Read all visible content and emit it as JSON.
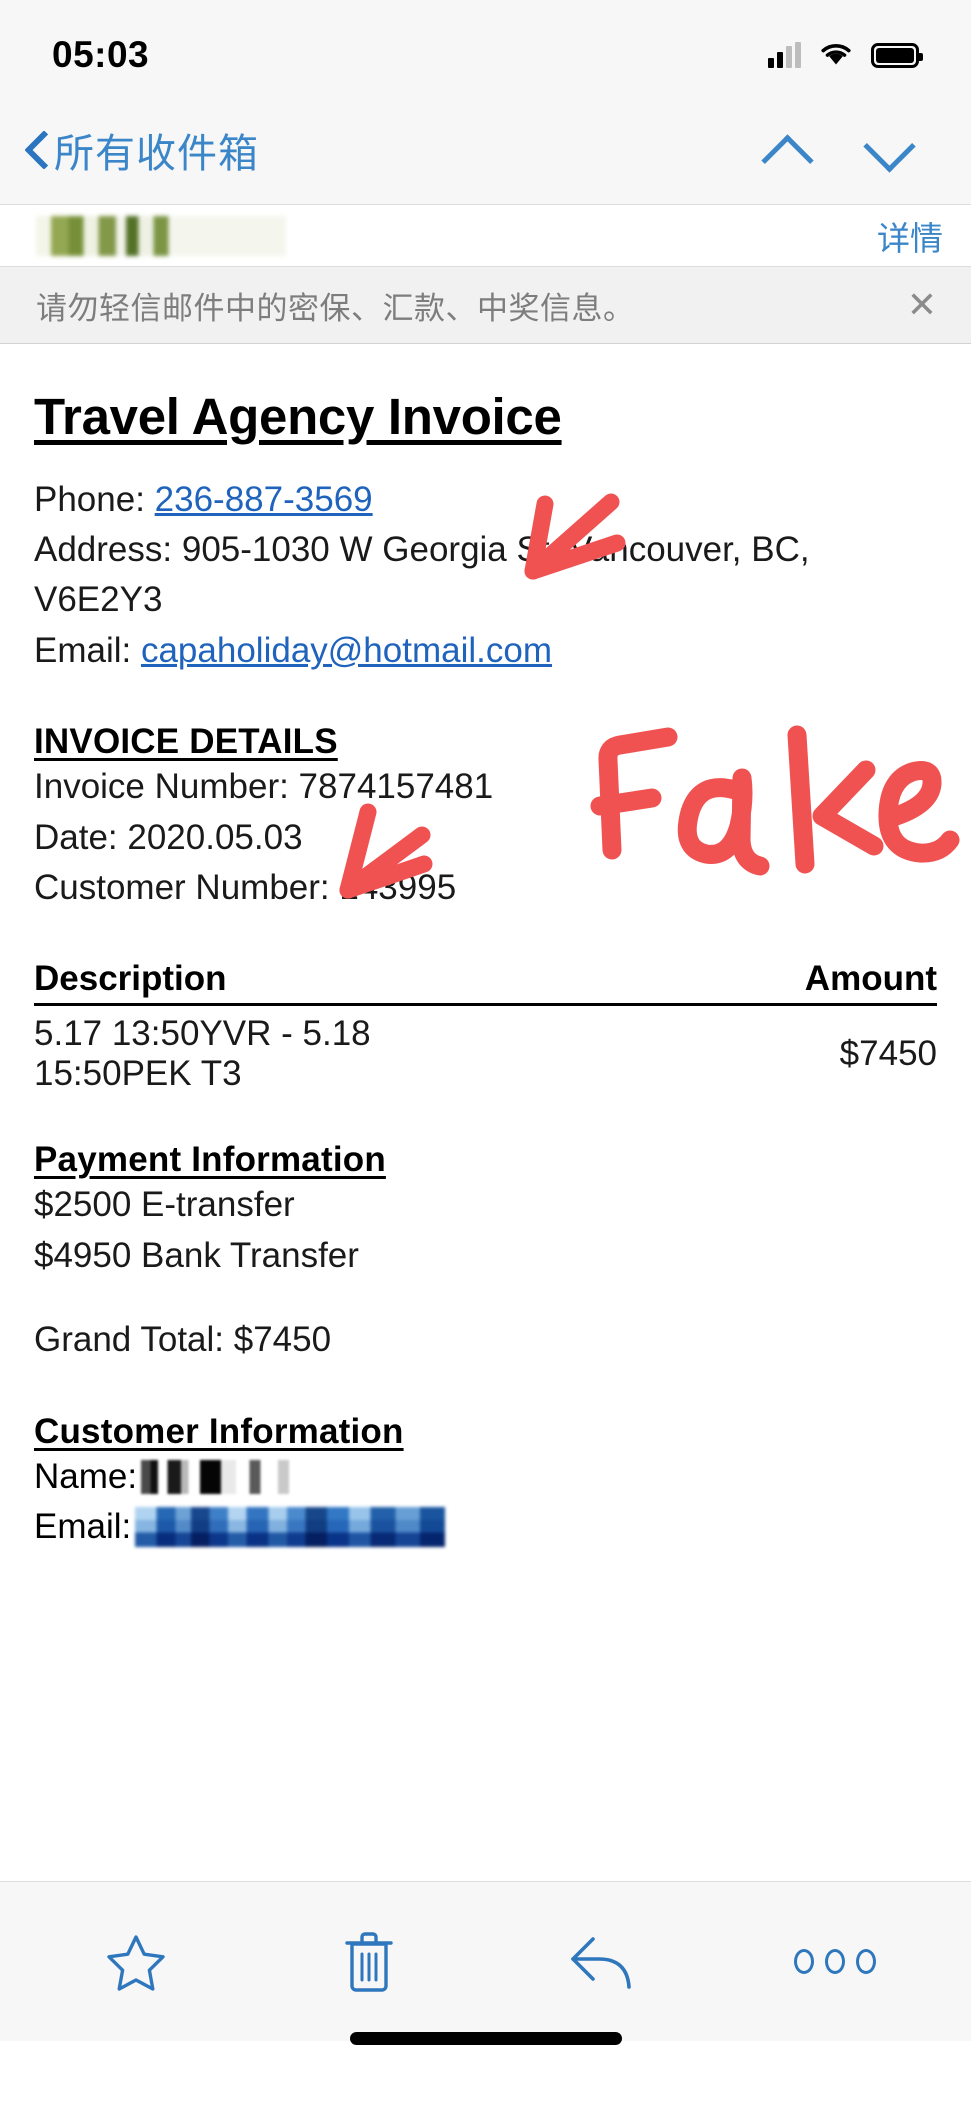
{
  "status_bar": {
    "time": "05:03",
    "signal_icon": "cellular-bars-icon",
    "wifi_icon": "wifi-icon",
    "battery_icon": "battery-full-icon"
  },
  "nav_bar": {
    "back_label": "所有收件箱",
    "back_icon": "chevron-left-icon",
    "prev_message_icon": "chevron-up-icon",
    "next_message_icon": "chevron-down-icon"
  },
  "sender_row": {
    "sender_redacted": "",
    "details_label": "详情"
  },
  "warning_banner": {
    "text": "请勿轻信邮件中的密保、汇款、中奖信息。",
    "close_icon": "close-icon",
    "close_glyph": "✕"
  },
  "invoice": {
    "title": "Travel Agency Invoice",
    "contact": {
      "phone_label": "Phone: ",
      "phone_value": "236-887-3569",
      "address_label": "Address: ",
      "address_value": "905-1030 W Georgia St, Vancouver, BC, V6E2Y3",
      "email_label": "Email: ",
      "email_value": "capaholiday@hotmail.com"
    },
    "details": {
      "heading": "INVOICE DETAILS",
      "invoice_number": "Invoice Number: 7874157481",
      "date": "Date: 2020.05.03",
      "customer_number": "Customer Number: 143995"
    },
    "table": {
      "columns": [
        "Description",
        "Amount"
      ],
      "rows": [
        {
          "description": "5.17 13:50YVR - 5.18 15:50PEK T3",
          "amount": "$7450"
        }
      ]
    },
    "payment": {
      "heading": "Payment Information",
      "lines": [
        "$2500 E-transfer",
        "$4950 Bank Transfer"
      ],
      "grand_total": "Grand Total: $7450"
    },
    "customer": {
      "heading": "Customer Information",
      "name_label": "Name:",
      "name_value_redacted": "",
      "email_label": "Email:",
      "email_value_redacted": ""
    }
  },
  "annotation": {
    "text": "Fake",
    "color": "#f05252",
    "arrow_upper_icon": "arrow-up-right-annotation-icon",
    "arrow_lower_icon": "arrow-up-left-annotation-icon"
  },
  "toolbar": {
    "flag_icon": "star-icon",
    "delete_icon": "trash-icon",
    "reply_icon": "reply-arrow-icon",
    "more_icon": "more-dots-icon"
  },
  "colors": {
    "accent_blue": "#3a86c8",
    "link_blue": "#1f63bd",
    "annotation_red": "#f05252",
    "banner_bg": "#f1f1f1",
    "chrome_bg": "#f7f7f7"
  }
}
